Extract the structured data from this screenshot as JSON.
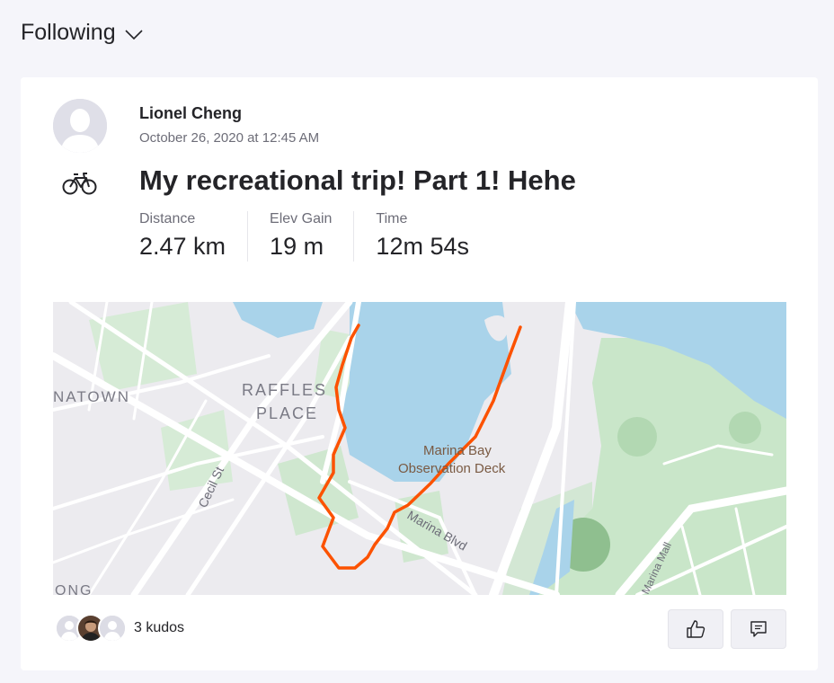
{
  "feed": {
    "filter_label": "Following"
  },
  "activity": {
    "athlete_name": "Lionel Cheng",
    "timestamp": "October 26, 2020 at 12:45 AM",
    "sport_icon": "bike-icon",
    "title": "My recreational trip! Part 1! Hehe",
    "stats": [
      {
        "label": "Distance",
        "value": "2.47 km"
      },
      {
        "label": "Elev Gain",
        "value": "19 m"
      },
      {
        "label": "Time",
        "value": "12m 54s"
      }
    ]
  },
  "map": {
    "labels": {
      "chinatown": "NATOWN",
      "raffles_1": "RAFFLES",
      "raffles_2": "PLACE",
      "cecil": "Cecil St",
      "poi_1": "Marina Bay",
      "poi_2": "Observation Deck",
      "marina_blvd": "Marina Blvd",
      "marina_mall": "Marina Mall",
      "bottom_left": "ONG"
    },
    "route_color": "#fc5200",
    "water_color": "#a9d3ea",
    "park_color": "#c9e6c9"
  },
  "social": {
    "kudos_label": "3 kudos",
    "kudos_icon": "thumbs-up-icon",
    "comment_icon": "comment-icon"
  }
}
